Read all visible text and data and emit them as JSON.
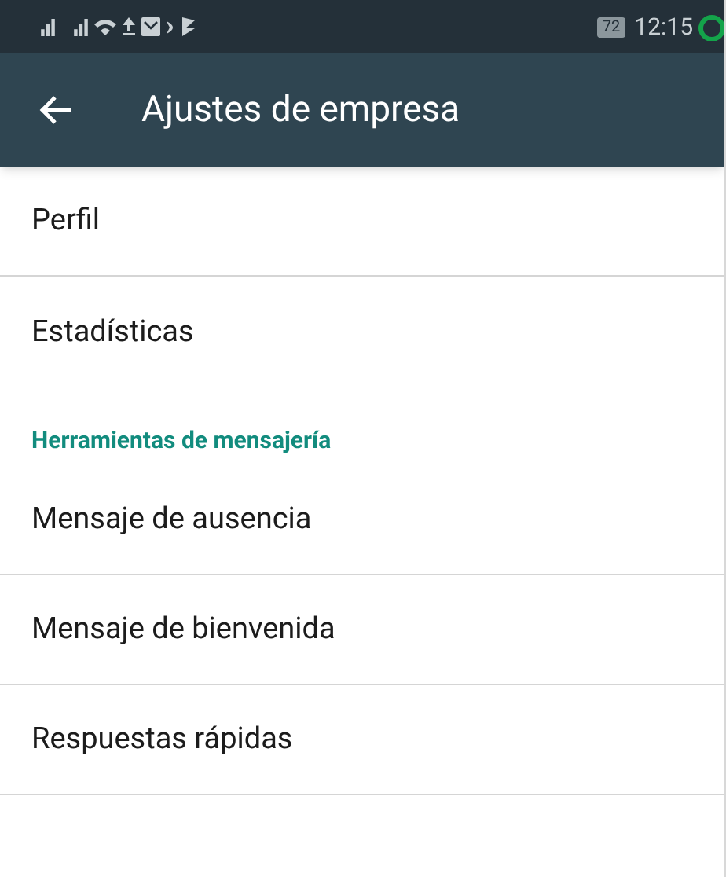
{
  "status_bar": {
    "battery": "72",
    "time": "12:15"
  },
  "app_bar": {
    "title": "Ajustes de empresa"
  },
  "items": [
    {
      "kind": "item",
      "label": "Perfil",
      "divider": true
    },
    {
      "kind": "item",
      "label": "Estadísticas",
      "divider": false
    },
    {
      "kind": "header",
      "label": "Herramientas de mensajería"
    },
    {
      "kind": "item",
      "label": "Mensaje de ausencia",
      "divider": true
    },
    {
      "kind": "item",
      "label": "Mensaje de bienvenida",
      "divider": true
    },
    {
      "kind": "item",
      "label": "Respuestas rápidas",
      "divider": true
    }
  ]
}
